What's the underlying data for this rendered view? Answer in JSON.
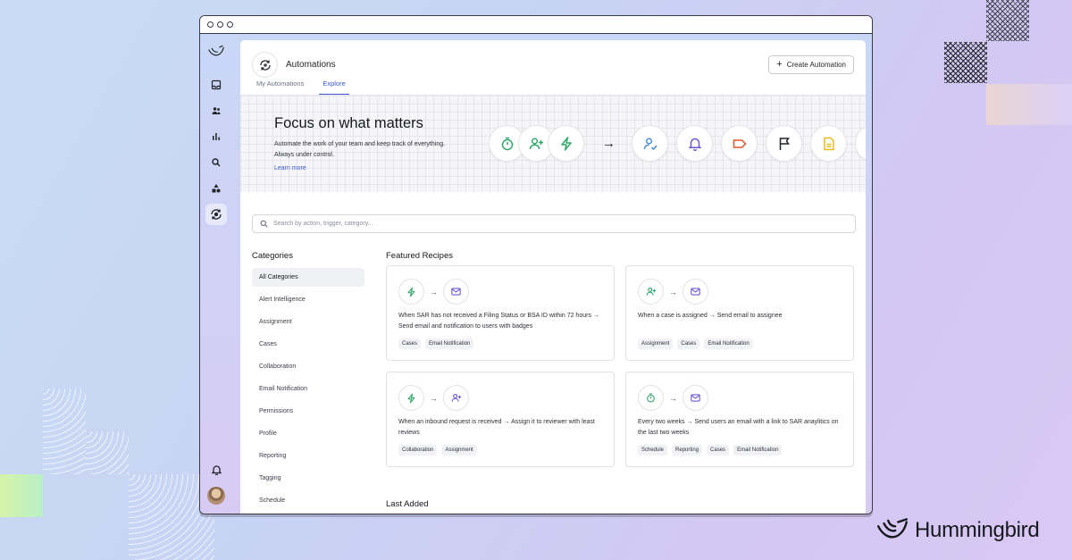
{
  "app": {
    "title": "Automations",
    "create_button": "Create Automation",
    "tabs": [
      {
        "label": "My Automations",
        "active": false
      },
      {
        "label": "Explore",
        "active": true
      }
    ]
  },
  "hero": {
    "title": "Focus on what matters",
    "subtitle": "Automate the work of your team and keep track of everything. Always under control.",
    "link": "Learn more",
    "flow_icons": [
      "timer-icon",
      "add-user-icon",
      "lightning-icon",
      "arrow-icon",
      "user-check-icon",
      "bell-icon",
      "tag-icon",
      "flag-icon",
      "document-icon"
    ]
  },
  "search": {
    "placeholder": "Search by action, trigger, category..."
  },
  "categories": {
    "heading": "Categories",
    "items": [
      "All Categories",
      "Alert Intelligence",
      "Assignment",
      "Cases",
      "Collaboration",
      "Email Notification",
      "Permissions",
      "Profile",
      "Reporting",
      "Tagging",
      "Schedule"
    ],
    "selected": "All Categories"
  },
  "featured": {
    "heading": "Featured Recipes",
    "recipes": [
      {
        "from_icon": "lightning-icon",
        "to_icon": "mail-icon",
        "trigger": "When SAR has not received a Filing Status or BSA ID within 72 hours",
        "action": "Send email and notification to users with badges",
        "tags": [
          "Cases",
          "Email Notification"
        ]
      },
      {
        "from_icon": "add-user-icon",
        "to_icon": "mail-icon",
        "trigger": "When a case is assigned",
        "action": "Send email to assignee",
        "tags": [
          "Assignment",
          "Cases",
          "Email Notification"
        ]
      },
      {
        "from_icon": "lightning-icon",
        "to_icon": "add-user-icon",
        "trigger": "When an inbound request is received",
        "action": "Assign it to reviewer with least reviews",
        "tags": [
          "Collaboration",
          "Assignment"
        ]
      },
      {
        "from_icon": "timer-icon",
        "to_icon": "mail-icon",
        "trigger": "Every two weeks",
        "action": "Send users an email with a link to SAR anaylitics on the last two weeks",
        "tags": [
          "Schedule",
          "Reporting",
          "Cases",
          "Email Notification"
        ]
      }
    ]
  },
  "last_added": {
    "heading": "Last Added"
  },
  "brand": {
    "name": "Hummingbird"
  },
  "colors": {
    "accent": "#3a5bcc",
    "green": "#2fa86a",
    "purple": "#6b5bd3",
    "orange": "#e5532d",
    "yellow": "#e8b923"
  },
  "arrow_glyph": "→"
}
